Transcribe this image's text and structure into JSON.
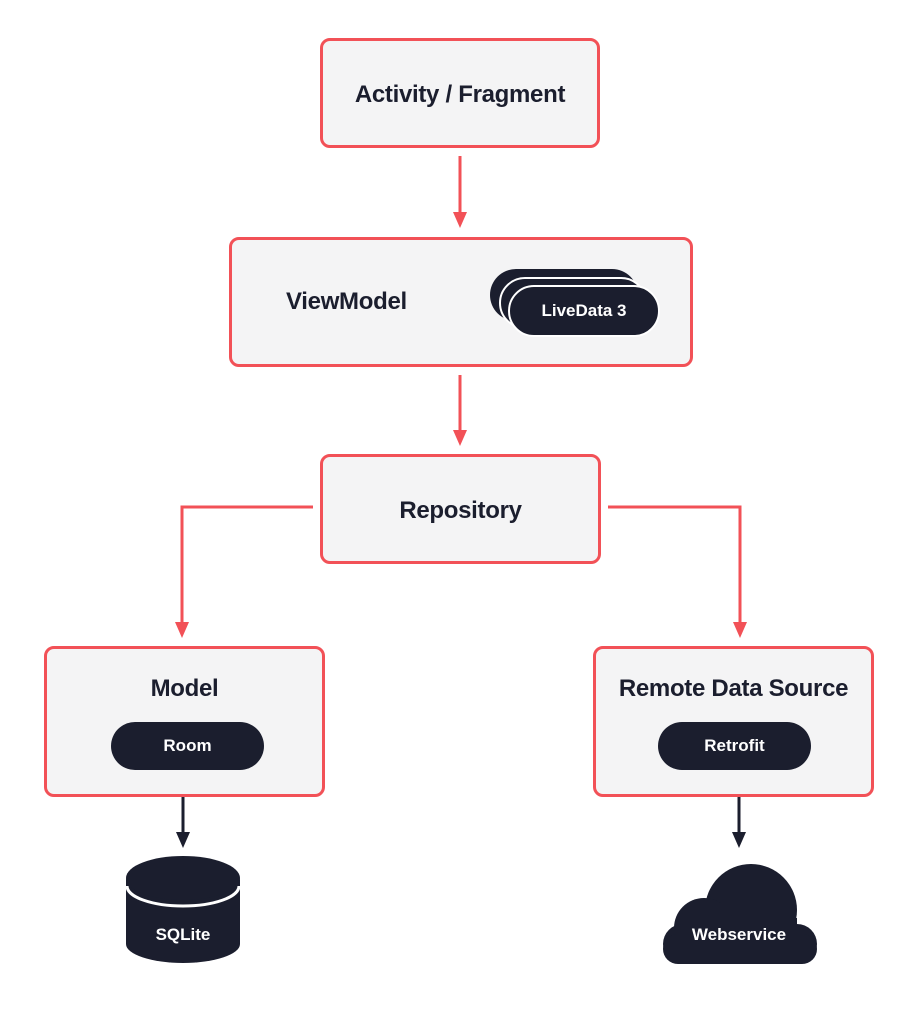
{
  "diagram": {
    "nodes": {
      "activity": {
        "label": "Activity / Fragment"
      },
      "viewmodel": {
        "label": "ViewModel",
        "badge": "LiveData 3",
        "badge_stack_count": 3
      },
      "repository": {
        "label": "Repository"
      },
      "model": {
        "label": "Model",
        "badge": "Room"
      },
      "remote": {
        "label": "Remote Data Source",
        "badge": "Retrofit"
      },
      "sqlite": {
        "label": "SQLite",
        "shape": "database-cylinder"
      },
      "webservice": {
        "label": "Webservice",
        "shape": "cloud"
      }
    },
    "edges": [
      {
        "from": "activity",
        "to": "viewmodel"
      },
      {
        "from": "viewmodel",
        "to": "repository"
      },
      {
        "from": "repository",
        "to": "model"
      },
      {
        "from": "repository",
        "to": "remote"
      },
      {
        "from": "model",
        "to": "sqlite"
      },
      {
        "from": "remote",
        "to": "webservice"
      }
    ],
    "colors": {
      "accent": "#f25157",
      "dark": "#1b1e2e",
      "box_fill": "#f4f4f5"
    }
  }
}
